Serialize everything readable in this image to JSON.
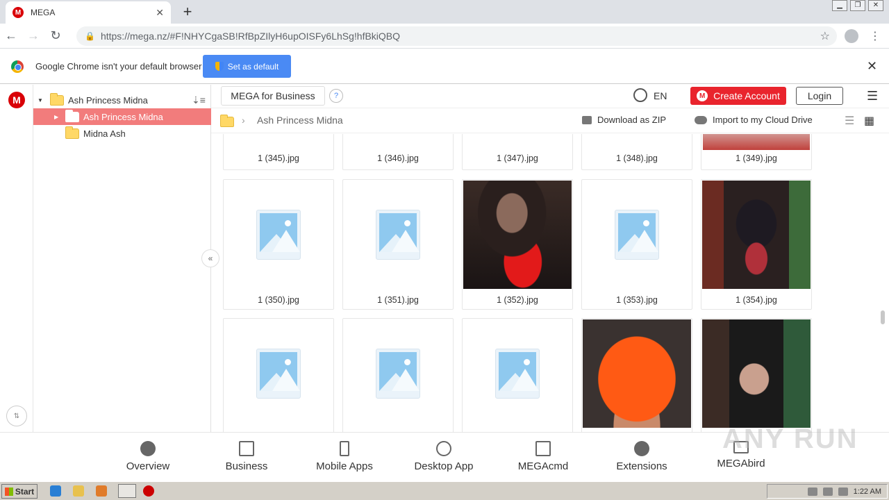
{
  "browser": {
    "tab_title": "MEGA",
    "tab_favicon": "M",
    "url": "https://mega.nz/#F!NHYCgaSB!RfBpZIlyH6upOISFy6LhSg!hfBkiQBQ",
    "infobar_text": "Google Chrome isn't your default browser",
    "set_default_label": "Set as default"
  },
  "mega": {
    "logo": "M",
    "tree": [
      {
        "label": "Ash Princess Midna",
        "expanded": true,
        "selected": false
      },
      {
        "label": "Ash Princess Midna",
        "expanded": false,
        "selected": true
      },
      {
        "label": "Midna Ash",
        "expanded": false,
        "selected": false
      }
    ],
    "business_label": "MEGA for Business",
    "help_label": "?",
    "lang": "EN",
    "create_account_label": "Create Account",
    "login_label": "Login",
    "breadcrumb": "Ash Princess Midna",
    "download_zip_label": "Download as ZIP",
    "import_label": "Import to my Cloud Drive",
    "files_row1": [
      "1 (345).jpg",
      "1 (346).jpg",
      "1 (347).jpg",
      "1 (348).jpg",
      "1 (349).jpg"
    ],
    "files_row2": [
      "1 (350).jpg",
      "1 (351).jpg",
      "1 (352).jpg",
      "1 (353).jpg",
      "1 (354).jpg"
    ]
  },
  "footer": {
    "items": [
      "Overview",
      "Business",
      "Mobile Apps",
      "Desktop App",
      "MEGAcmd",
      "Extensions",
      "MEGAbird"
    ]
  },
  "watermark": "ANY RUN",
  "taskbar": {
    "start_label": "Start",
    "clock": "1:22 AM"
  },
  "colors": {
    "mega_red": "#d90007",
    "create_btn": "#e9242d",
    "selected_folder": "#f27c7c",
    "chrome_blue": "#4a8af4"
  }
}
